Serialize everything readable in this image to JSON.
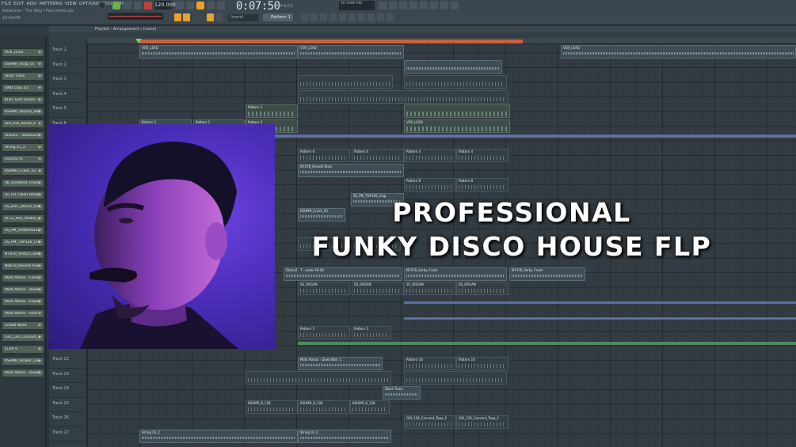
{
  "menu": [
    "FILE",
    "EDIT",
    "ADD",
    "PATTERNS",
    "VIEW",
    "OPTIONS",
    "TOOLS",
    "HELP"
  ],
  "project": {
    "title": "Ketamine - The Way I Feel remix.zip",
    "time": "23:04:08"
  },
  "transport": {
    "tempo": "120.000",
    "song_time": "0:07:50",
    "song_time_sub": "M:S:CS"
  },
  "hint": "(none)",
  "pattern_selector": "Pattern 1",
  "cpu": {
    "label": "26",
    "mem": "5896 MB"
  },
  "playlist": {
    "title": "Playlist - Arrangement › (none)"
  },
  "channels": [
    "VOX_LEAD",
    "KSHMR_Snap_01",
    "Short Trans",
    "UNO Clap 1/3",
    "KLRT Tech House - 11",
    "KSHMR_Impact_with",
    "dnt_kick_bomb_4",
    "Stickz2 - Tambourine",
    "String 01_2",
    "Felicity FX",
    "KSHMR_Crash_02",
    "nb_snowfeet_crash_",
    "HI_TSC Open Hihat 004",
    "SS_DSC_DISCO_SOUL",
    "RF12_R02_shaker_L",
    "SS_PM_OHWORDS16",
    "SS_PM_TOP126_Crash",
    "N7478_Verby Crash",
    "N0678_Reverb Riser",
    "Mink Atmos - Clock 1",
    "Mink Atmos - Downlift",
    "Mink Atmos - Impact",
    "Mink Atmos - Riser 1",
    "Crowd Noise",
    "GRI_126_Concord_Topa",
    "CLAP 9",
    "KSHMR_Shaker_Loop",
    "Mink Atmos - Downlift"
  ],
  "tracks": [
    "Track 1",
    "Track 2",
    "Track 3",
    "Track 4",
    "Track 5",
    "Track 6",
    "Track 22",
    "Track 23",
    "Track 24",
    "Track 25",
    "Track 26",
    "Track 27"
  ],
  "clip_labels": {
    "vox_lead": "VOX_LEAD",
    "pattern_1": "Pattern 1",
    "pattern_2": "Pattern 2",
    "pattern_3": "Pattern 3",
    "pattern_4": "Pattern 4",
    "pattern_5": "Pattern 5",
    "pattern_6": "Pattern 6",
    "pattern_8": "Pattern 8",
    "pattern_10": "Pattern 10",
    "pattern_16": "Pattern 16",
    "reverb_riser": "N7478_Reverb Riser",
    "crash": "KSHMR_Crash_02",
    "open_hihat": "SS_PM_TOP126_Clap",
    "verby_crash": "N7478_Verby Crash",
    "stickz": "Stickz2 - T...umbo F8 02",
    "organ": "SS_ORGAN",
    "downlift": "Mink Atmos - Downlifter 1",
    "short_trans": "Short Trans",
    "shaker": "KSHMR_8_128",
    "concord": "GRI_126_Concord_Topa_2",
    "string": "String 01_2"
  },
  "headline": {
    "line1": "PROFESSIONAL",
    "line2": "FUNKY DISCO HOUSE FLP"
  },
  "colors": {
    "accent": "#e9a22b",
    "loop": "#c9613e",
    "marker": "#75d24a"
  }
}
